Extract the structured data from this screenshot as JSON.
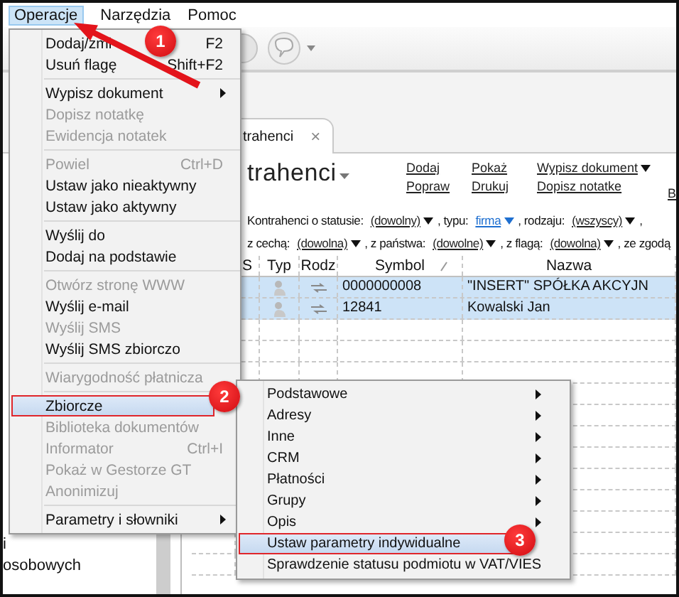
{
  "menu_bar": [
    {
      "label": "Operacje",
      "selected": true
    },
    {
      "label": "Narzędzia",
      "selected": false
    },
    {
      "label": "Pomoc",
      "selected": false
    }
  ],
  "toolbar": {
    "help_caret": true
  },
  "tab": {
    "label": "trahenci",
    "close": "×"
  },
  "heading": "trahenci",
  "actions": [
    [
      {
        "label": "Dodaj",
        "dropdown": false
      },
      {
        "label": "Popraw",
        "dropdown": false
      }
    ],
    [
      {
        "label": "Pokaż",
        "dropdown": false
      },
      {
        "label": "Drukuj",
        "dropdown": false
      }
    ],
    [
      {
        "label": "Wypisz dokument",
        "dropdown": true
      },
      {
        "label": "Dopisz notatke",
        "dropdown": false
      }
    ],
    [
      {
        "label": "B",
        "dropdown": false
      }
    ]
  ],
  "filters": [
    [
      {
        "kind": "text",
        "text": "Kontrahenci o statusie:"
      },
      {
        "kind": "dropdown",
        "text": "(dowolny)",
        "set": false
      },
      {
        "kind": "text",
        "text": ", typu:"
      },
      {
        "kind": "dropdown",
        "text": "firma",
        "set": true
      },
      {
        "kind": "text",
        "text": ", rodzaju:"
      },
      {
        "kind": "dropdown",
        "text": "(wszyscy)",
        "set": false
      },
      {
        "kind": "text",
        "text": ","
      }
    ],
    [
      {
        "kind": "text",
        "text": "z cechą:"
      },
      {
        "kind": "dropdown",
        "text": "(dowolna)",
        "set": false
      },
      {
        "kind": "text",
        "text": ", z państwa:"
      },
      {
        "kind": "dropdown",
        "text": "(dowolne)",
        "set": false
      },
      {
        "kind": "text",
        "text": ", z flagą:"
      },
      {
        "kind": "dropdown",
        "text": "(dowolna)",
        "set": false
      },
      {
        "kind": "text",
        "text": ", ze zgodą"
      }
    ]
  ],
  "table": {
    "columns": [
      {
        "label": "S",
        "sorted": false
      },
      {
        "label": "Typ",
        "sorted": false
      },
      {
        "label": "Rodz",
        "sorted": false
      },
      {
        "label": "Symbol",
        "sorted": true
      },
      {
        "label": "Nazwa",
        "sorted": false
      }
    ],
    "rows": [
      {
        "symbol": "0000000008",
        "name": "\"INSERT\" SPÓŁKA AKCYJN",
        "selected": true
      },
      {
        "symbol": "12841",
        "name": "Kowalski Jan",
        "selected": true
      }
    ]
  },
  "left_panel": [
    "i",
    "osobowych"
  ],
  "menu": [
    {
      "kind": "item",
      "label": "Dodaj/zmi",
      "shortcut": "F2",
      "disabled": false,
      "selected": false
    },
    {
      "kind": "item",
      "label": "Usuń flagę",
      "shortcut": "Shift+F2",
      "disabled": false,
      "selected": false
    },
    {
      "kind": "separator"
    },
    {
      "kind": "item",
      "label": "Wypisz dokument",
      "disabled": false,
      "has_submenu": true,
      "selected": false
    },
    {
      "kind": "item",
      "label": "Dopisz notatkę",
      "disabled": true,
      "selected": false
    },
    {
      "kind": "item",
      "label": "Ewidencja notatek",
      "disabled": true,
      "selected": false
    },
    {
      "kind": "separator"
    },
    {
      "kind": "item",
      "label": "Powiel",
      "shortcut": "Ctrl+D",
      "disabled": true,
      "selected": false
    },
    {
      "kind": "item",
      "label": "Ustaw jako nieaktywny",
      "disabled": false,
      "selected": false
    },
    {
      "kind": "item",
      "label": "Ustaw jako aktywny",
      "disabled": false,
      "selected": false
    },
    {
      "kind": "separator"
    },
    {
      "kind": "item",
      "label": "Wyślij do",
      "disabled": false,
      "selected": false
    },
    {
      "kind": "item",
      "label": "Dodaj na podstawie",
      "disabled": false,
      "selected": false
    },
    {
      "kind": "separator"
    },
    {
      "kind": "item",
      "label": "Otwórz stronę WWW",
      "disabled": true,
      "selected": false
    },
    {
      "kind": "item",
      "label": "Wyślij e-mail",
      "disabled": false,
      "selected": false
    },
    {
      "kind": "item",
      "label": "Wyślij SMS",
      "disabled": true,
      "selected": false
    },
    {
      "kind": "item",
      "label": "Wyślij SMS zbiorczo",
      "disabled": false,
      "selected": false
    },
    {
      "kind": "separator"
    },
    {
      "kind": "item",
      "label": "Wiarygodność płatnicza",
      "disabled": true,
      "selected": false
    },
    {
      "kind": "separator"
    },
    {
      "kind": "item",
      "label": "Zbiorcze",
      "disabled": false,
      "selected": true
    },
    {
      "kind": "item",
      "label": "Biblioteka dokumentów",
      "disabled": true,
      "selected": false
    },
    {
      "kind": "item",
      "label": "Informator",
      "shortcut": "Ctrl+I",
      "disabled": true,
      "selected": false
    },
    {
      "kind": "item",
      "label": "Pokaż w Gestorze GT",
      "disabled": true,
      "selected": false
    },
    {
      "kind": "item",
      "label": "Anonimizuj",
      "disabled": true,
      "selected": false
    },
    {
      "kind": "separator"
    },
    {
      "kind": "item",
      "label": "Parametry i słowniki",
      "disabled": false,
      "has_submenu": true,
      "selected": false
    }
  ],
  "submenu": [
    {
      "label": "Podstawowe",
      "has_submenu": true,
      "selected": false
    },
    {
      "label": "Adresy",
      "has_submenu": true,
      "selected": false
    },
    {
      "label": "Inne",
      "has_submenu": true,
      "selected": false
    },
    {
      "label": "CRM",
      "has_submenu": true,
      "selected": false
    },
    {
      "label": "Płatności",
      "has_submenu": true,
      "selected": false
    },
    {
      "label": "Grupy",
      "has_submenu": true,
      "selected": false
    },
    {
      "label": "Opis",
      "has_submenu": true,
      "selected": false
    },
    {
      "label": "Ustaw parametry indywidualne",
      "has_submenu": false,
      "selected": true
    },
    {
      "label": "Sprawdzenie statusu podmiotu w VAT/VIES",
      "has_submenu": false,
      "selected": false
    }
  ],
  "annotations": [
    "1",
    "2",
    "3"
  ]
}
